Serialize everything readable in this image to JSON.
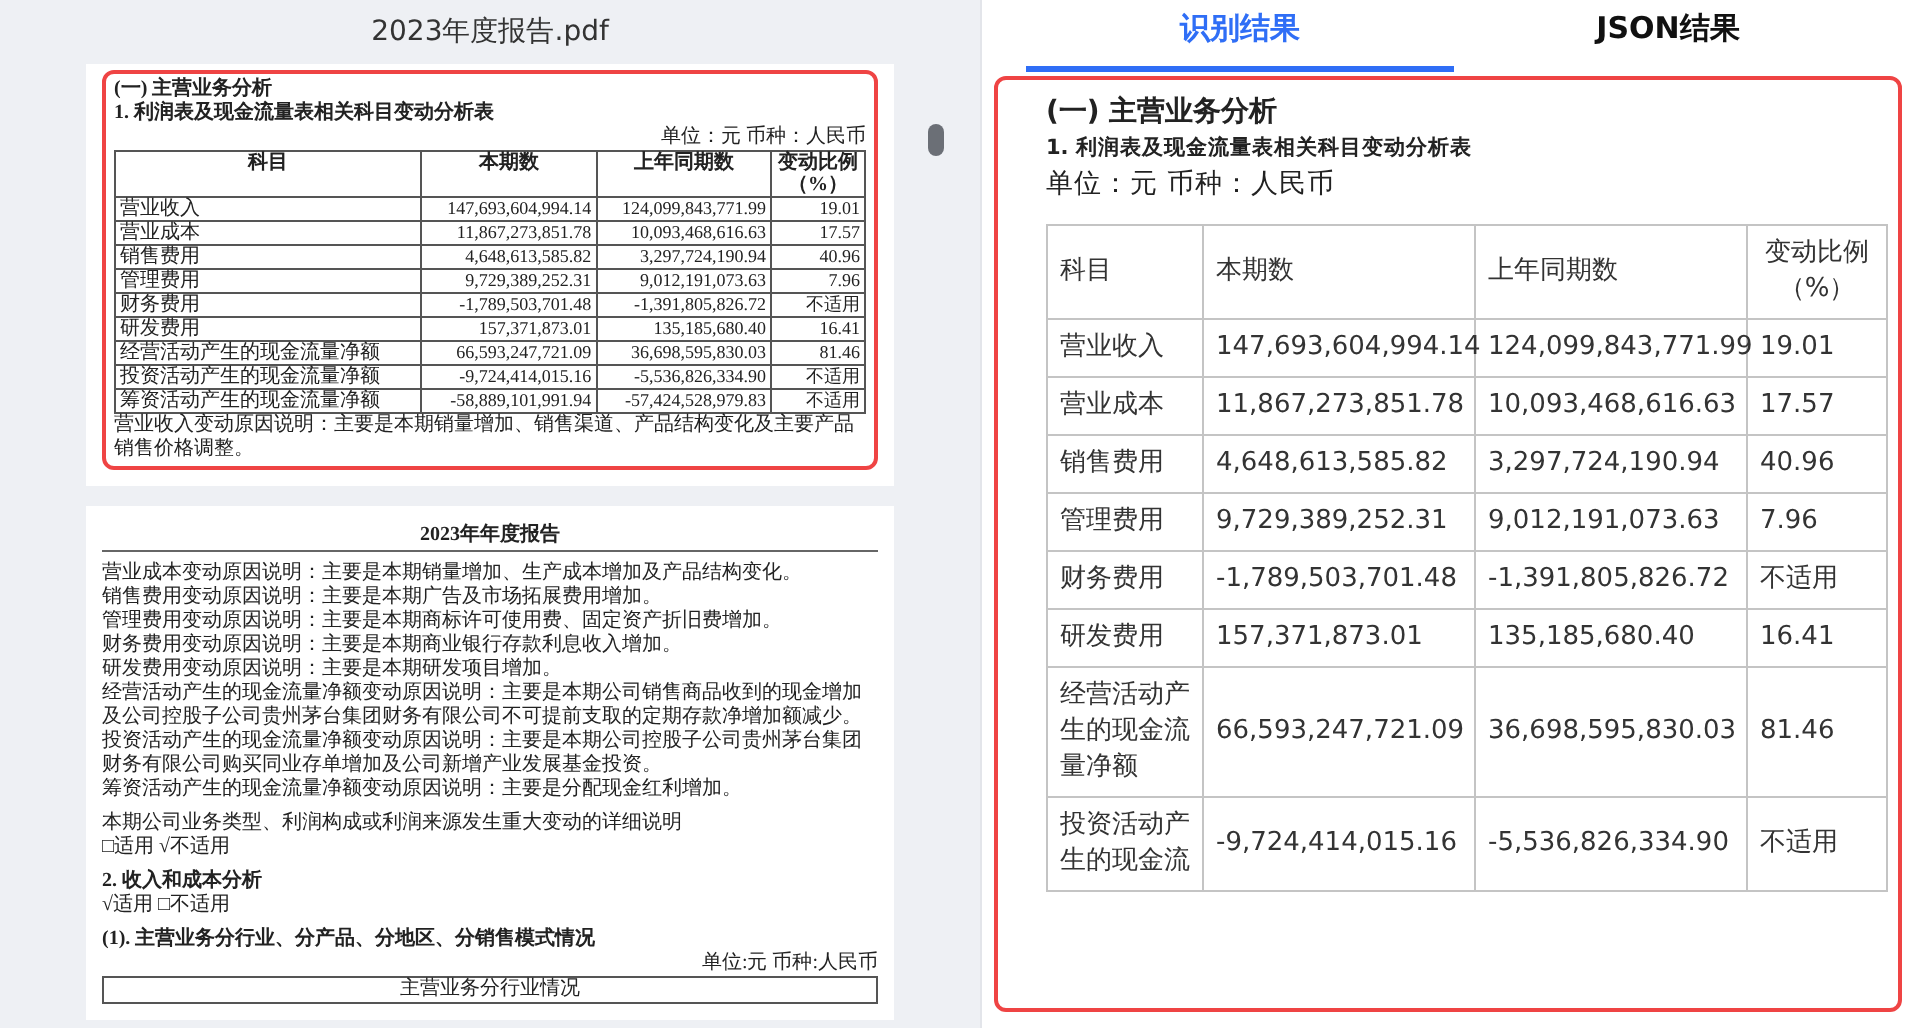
{
  "pdf_viewer": {
    "title": "2023年度报告.pdf",
    "page_1": {
      "heading": "(一) 主营业务分析",
      "subheading": "1.  利润表及现金流量表相关科目变动分析表",
      "unit": "单位：元 币种：人民币",
      "table": {
        "columns": [
          "科目",
          "本期数",
          "上年同期数",
          "变动比例（%）"
        ],
        "rows": [
          [
            "营业收入",
            "147,693,604,994.14",
            "124,099,843,771.99",
            "19.01"
          ],
          [
            "营业成本",
            "11,867,273,851.78",
            "10,093,468,616.63",
            "17.57"
          ],
          [
            "销售费用",
            "4,648,613,585.82",
            "3,297,724,190.94",
            "40.96"
          ],
          [
            "管理费用",
            "9,729,389,252.31",
            "9,012,191,073.63",
            "7.96"
          ],
          [
            "财务费用",
            "-1,789,503,701.48",
            "-1,391,805,826.72",
            "不适用"
          ],
          [
            "研发费用",
            "157,371,873.01",
            "135,185,680.40",
            "16.41"
          ],
          [
            "经营活动产生的现金流量净额",
            "66,593,247,721.09",
            "36,698,595,830.03",
            "81.46"
          ],
          [
            "投资活动产生的现金流量净额",
            "-9,724,414,015.16",
            "-5,536,826,334.90",
            "不适用"
          ],
          [
            "筹资活动产生的现金流量净额",
            "-58,889,101,991.94",
            "-57,424,528,979.83",
            "不适用"
          ]
        ]
      },
      "note": "营业收入变动原因说明：主要是本期销量增加、销售渠道、产品结构变化及主要产品销售价格调整。"
    },
    "page_2": {
      "running_header": "2023年年度报告",
      "paragraphs": [
        "营业成本变动原因说明：主要是本期销量增加、生产成本增加及产品结构变化。",
        "销售费用变动原因说明：主要是本期广告及市场拓展费用增加。",
        "管理费用变动原因说明：主要是本期商标许可使用费、固定资产折旧费增加。",
        "财务费用变动原因说明：主要是本期商业银行存款利息收入增加。",
        "研发费用变动原因说明：主要是本期研发项目增加。",
        "经营活动产生的现金流量净额变动原因说明：主要是本期公司销售商品收到的现金增加及公司控股子公司贵州茅台集团财务有限公司不可提前支取的定期存款净增加额减少。",
        "投资活动产生的现金流量净额变动原因说明：主要是本期公司控股子公司贵州茅台集团财务有限公司购买同业存单增加及公司新增产业发展基金投资。",
        "筹资活动产生的现金流量净额变动原因说明：主要是分配现金红利增加。"
      ],
      "detail_note": "本期公司业务类型、利润构成或利润来源发生重大变动的详细说明",
      "detail_options": "□适用 √不适用",
      "section_title": "2.  收入和成本分析",
      "section_options": "√适用 □不适用",
      "subsection_title": "(1). 主营业务分行业、分产品、分地区、分销售模式情况",
      "unit": "单位:元 币种:人民币",
      "table_caption": "主营业务分行业情况"
    }
  },
  "result_panel": {
    "tabs": [
      {
        "label": "识别结果",
        "selected": true
      },
      {
        "label": "JSON结果",
        "selected": false
      }
    ],
    "heading": "(一) 主营业务分析",
    "subheading": "1. 利润表及现金流量表相关科目变动分析表",
    "unit": "单位：元 币种：人民币",
    "table": {
      "columns": [
        "科目",
        "本期数",
        "上年同期数",
        "变动比例（%）"
      ],
      "rows": [
        [
          "营业收入",
          "147,693,604,994.14",
          "124,099,843,771.99",
          "19.01"
        ],
        [
          "营业成本",
          "11,867,273,851.78",
          "10,093,468,616.63",
          "17.57"
        ],
        [
          "销售费用",
          "4,648,613,585.82",
          "3,297,724,190.94",
          "40.96"
        ],
        [
          "管理费用",
          "9,729,389,252.31",
          "9,012,191,073.63",
          "7.96"
        ],
        [
          "财务费用",
          "-1,789,503,701.48",
          "-1,391,805,826.72",
          "不适用"
        ],
        [
          "研发费用",
          "157,371,873.01",
          "135,185,680.40",
          "16.41"
        ],
        [
          "经营活动产生的现金流量净额",
          "66,593,247,721.09",
          "36,698,595,830.03",
          "81.46"
        ],
        [
          "投资活动产生的现金流",
          "-9,724,414,015.16",
          "-5,536,826,334.90",
          "不适用"
        ]
      ]
    }
  }
}
